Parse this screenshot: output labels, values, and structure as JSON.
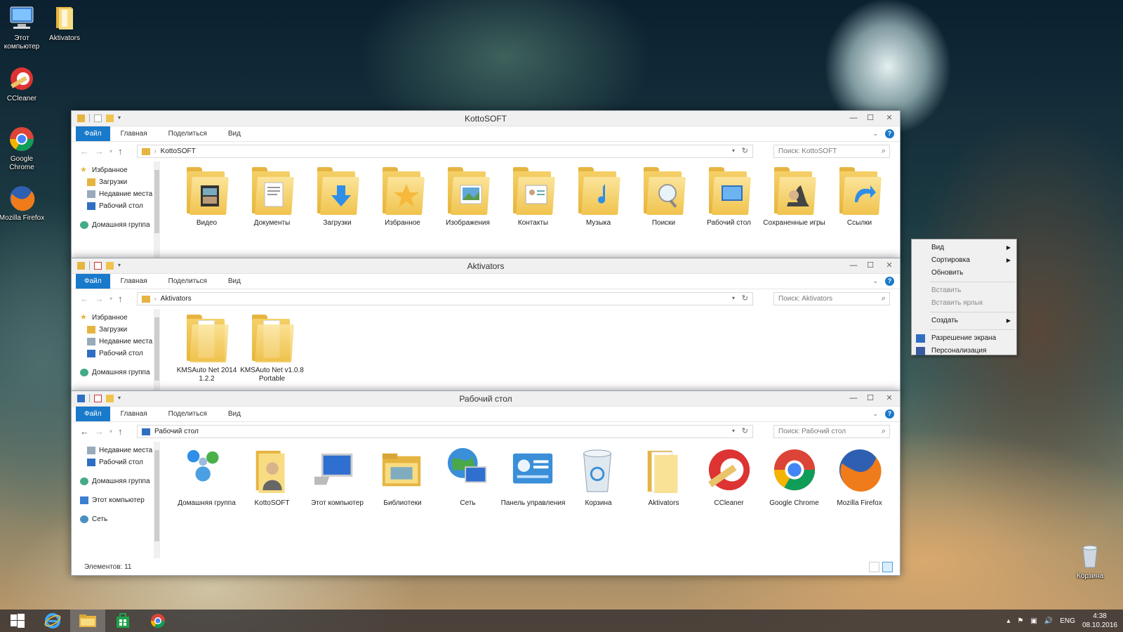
{
  "desktop": {
    "icons": [
      {
        "label": "Этот компьютер"
      },
      {
        "label": "Aktivators"
      },
      {
        "label": "CCleaner"
      },
      {
        "label": "Google Chrome"
      },
      {
        "label": "Mozilla Firefox"
      },
      {
        "label": "Корзина"
      }
    ]
  },
  "ribbon": {
    "file": "Файл",
    "home": "Главная",
    "share": "Поделиться",
    "view": "Вид"
  },
  "window1": {
    "title": "KottoSOFT",
    "address": "KottoSOFT",
    "search_placeholder": "Поиск: KottoSOFT",
    "nav": [
      "Избранное",
      "Загрузки",
      "Недавние места",
      "Рабочий стол",
      "Домашняя группа"
    ],
    "items": [
      {
        "label": "Видео"
      },
      {
        "label": "Документы"
      },
      {
        "label": "Загрузки"
      },
      {
        "label": "Избранное"
      },
      {
        "label": "Изображения"
      },
      {
        "label": "Контакты"
      },
      {
        "label": "Музыка"
      },
      {
        "label": "Поиски"
      },
      {
        "label": "Рабочий стол"
      },
      {
        "label": "Сохраненные игры"
      },
      {
        "label": "Ссылки"
      }
    ]
  },
  "window2": {
    "title": "Aktivators",
    "address": "Aktivators",
    "search_placeholder": "Поиск: Aktivators",
    "nav": [
      "Избранное",
      "Загрузки",
      "Недавние места",
      "Рабочий стол",
      "Домашняя группа"
    ],
    "items": [
      {
        "label": "KMSAuto Net 2014 1.2.2"
      },
      {
        "label": "KMSAuto Net v1.0.8 Portable"
      }
    ]
  },
  "window3": {
    "title": "Рабочий стол",
    "address": "Рабочий стол",
    "search_placeholder": "Поиск: Рабочий стол",
    "nav": [
      "Недавние места",
      "Рабочий стол",
      "Домашняя группа",
      "Этот компьютер",
      "Сеть"
    ],
    "items": [
      {
        "label": "Домашняя группа"
      },
      {
        "label": "KottoSOFT"
      },
      {
        "label": "Этот компьютер"
      },
      {
        "label": "Библиотеки"
      },
      {
        "label": "Сеть"
      },
      {
        "label": "Панель управления"
      },
      {
        "label": "Корзина"
      },
      {
        "label": "Aktivators"
      },
      {
        "label": "CCleaner"
      },
      {
        "label": "Google Chrome"
      },
      {
        "label": "Mozilla Firefox"
      }
    ],
    "status": "Элементов: 11"
  },
  "context_menu": {
    "items": [
      {
        "label": "Вид"
      },
      {
        "label": "Сортировка"
      },
      {
        "label": "Обновить"
      },
      {
        "label": "Вставить"
      },
      {
        "label": "Вставить ярлык"
      },
      {
        "label": "Создать"
      },
      {
        "label": "Разрешение экрана"
      },
      {
        "label": "Персонализация"
      }
    ]
  },
  "taskbar": {
    "language": "ENG",
    "time": "4:38",
    "date": "08.10.2016"
  },
  "colors": {
    "accent": "#1979ca",
    "folder": "#f0c34d"
  }
}
